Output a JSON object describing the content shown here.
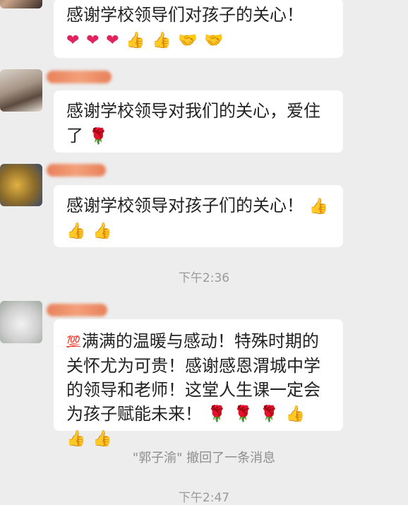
{
  "messages": [
    {
      "text": "感谢学校领导们对孩子的关心！",
      "emojis": [
        "heart",
        "heart",
        "heart",
        "thumbs-up",
        "thumbs-up",
        "handshake",
        "handshake"
      ]
    },
    {
      "text": "感谢学校领导对我们的关心，爱住了",
      "emojis": [
        "rose"
      ]
    },
    {
      "text": "感谢学校领导对孩子们的关心！",
      "emojis": [
        "thumbs-up",
        "thumbs-up",
        "thumbs-up"
      ]
    },
    {
      "text": "满满的温暖与感动！特殊时期的关怀尤为可贵！感谢感恩渭城中学的领导和老师！这堂人生课一定会为孩子赋能未来！",
      "lead_emoji": "hundred-points",
      "emojis": [
        "rose",
        "rose",
        "rose",
        "thumbs-up",
        "thumbs-up",
        "thumbs-up"
      ]
    }
  ],
  "time_separator": "下午2:36",
  "recall_notice": "\"郭子渝\" 撤回了一条消息",
  "bottom_time_partial": "下午2:47",
  "glyphs": {
    "heart": "❤",
    "thumbs-up": "👍",
    "handshake": "🤝",
    "rose": "🌹",
    "hundred-points": "💯"
  },
  "colors": {
    "background": "#ededed",
    "bubble": "#ffffff",
    "time_text": "#9a9a9a"
  }
}
